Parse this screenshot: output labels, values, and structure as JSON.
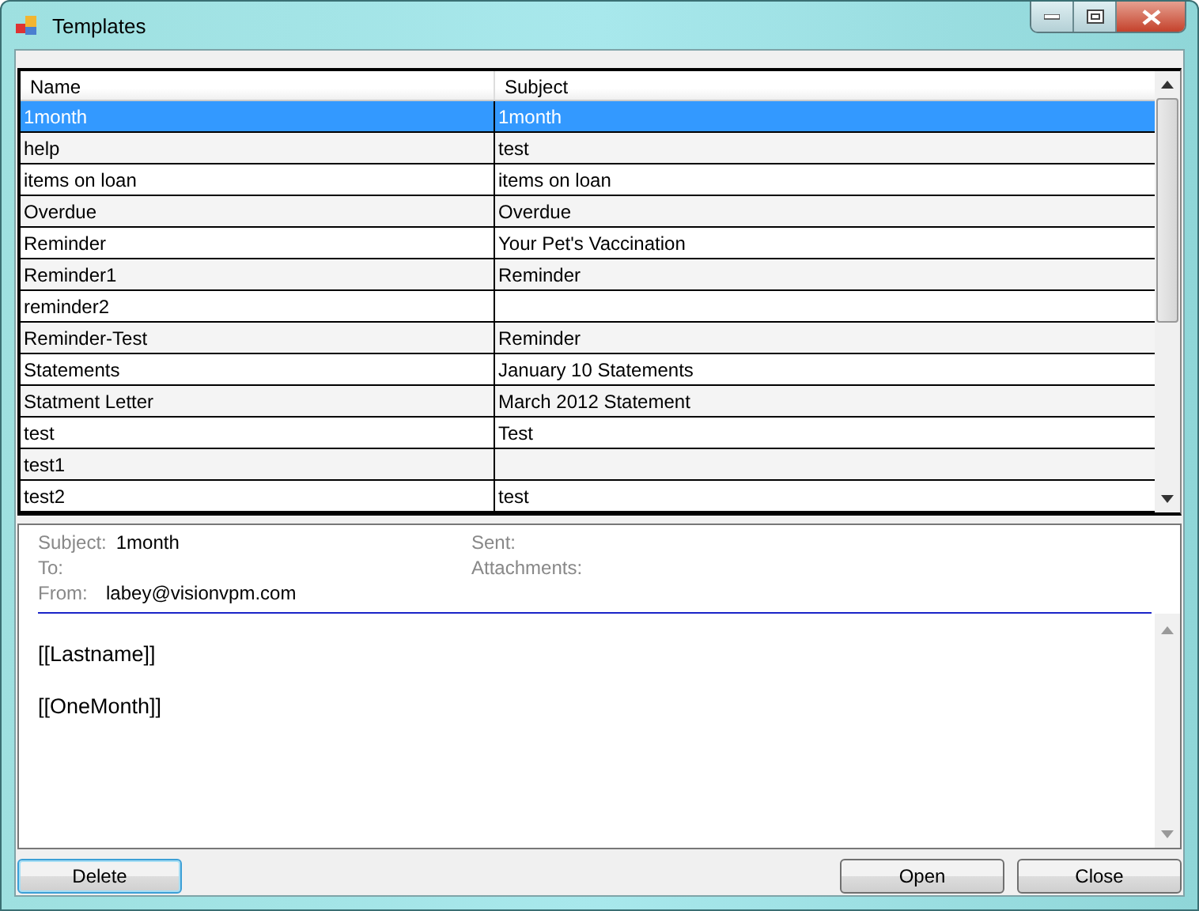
{
  "window": {
    "title": "Templates"
  },
  "table": {
    "columns": [
      "Name",
      "Subject"
    ],
    "rows": [
      {
        "name": "1month",
        "subject": "1month",
        "selected": true
      },
      {
        "name": "help",
        "subject": "test",
        "selected": false
      },
      {
        "name": "items on loan",
        "subject": "items on loan",
        "selected": false
      },
      {
        "name": "Overdue",
        "subject": "Overdue",
        "selected": false
      },
      {
        "name": "Reminder",
        "subject": "Your Pet's Vaccination",
        "selected": false
      },
      {
        "name": "Reminder1",
        "subject": "Reminder",
        "selected": false
      },
      {
        "name": "reminder2",
        "subject": "",
        "selected": false
      },
      {
        "name": "Reminder-Test",
        "subject": "Reminder",
        "selected": false
      },
      {
        "name": "Statements",
        "subject": "January 10 Statements",
        "selected": false
      },
      {
        "name": "Statment Letter",
        "subject": "March 2012 Statement",
        "selected": false
      },
      {
        "name": "test",
        "subject": "Test",
        "selected": false
      },
      {
        "name": "test1",
        "subject": "",
        "selected": false
      },
      {
        "name": "test2",
        "subject": "test",
        "selected": false
      }
    ]
  },
  "preview": {
    "subject_label": "Subject:",
    "subject": "1month",
    "to_label": "To:",
    "from_label": "From:",
    "from": "labey@visionvpm.com",
    "sent_label": "Sent:",
    "attachments_label": "Attachments:",
    "body": [
      "[[Lastname]]",
      "[[OneMonth]]"
    ]
  },
  "buttons": [
    {
      "label": "Delete",
      "focused": true
    },
    {
      "label": "Open",
      "focused": false
    },
    {
      "label": "Close",
      "focused": false
    }
  ]
}
